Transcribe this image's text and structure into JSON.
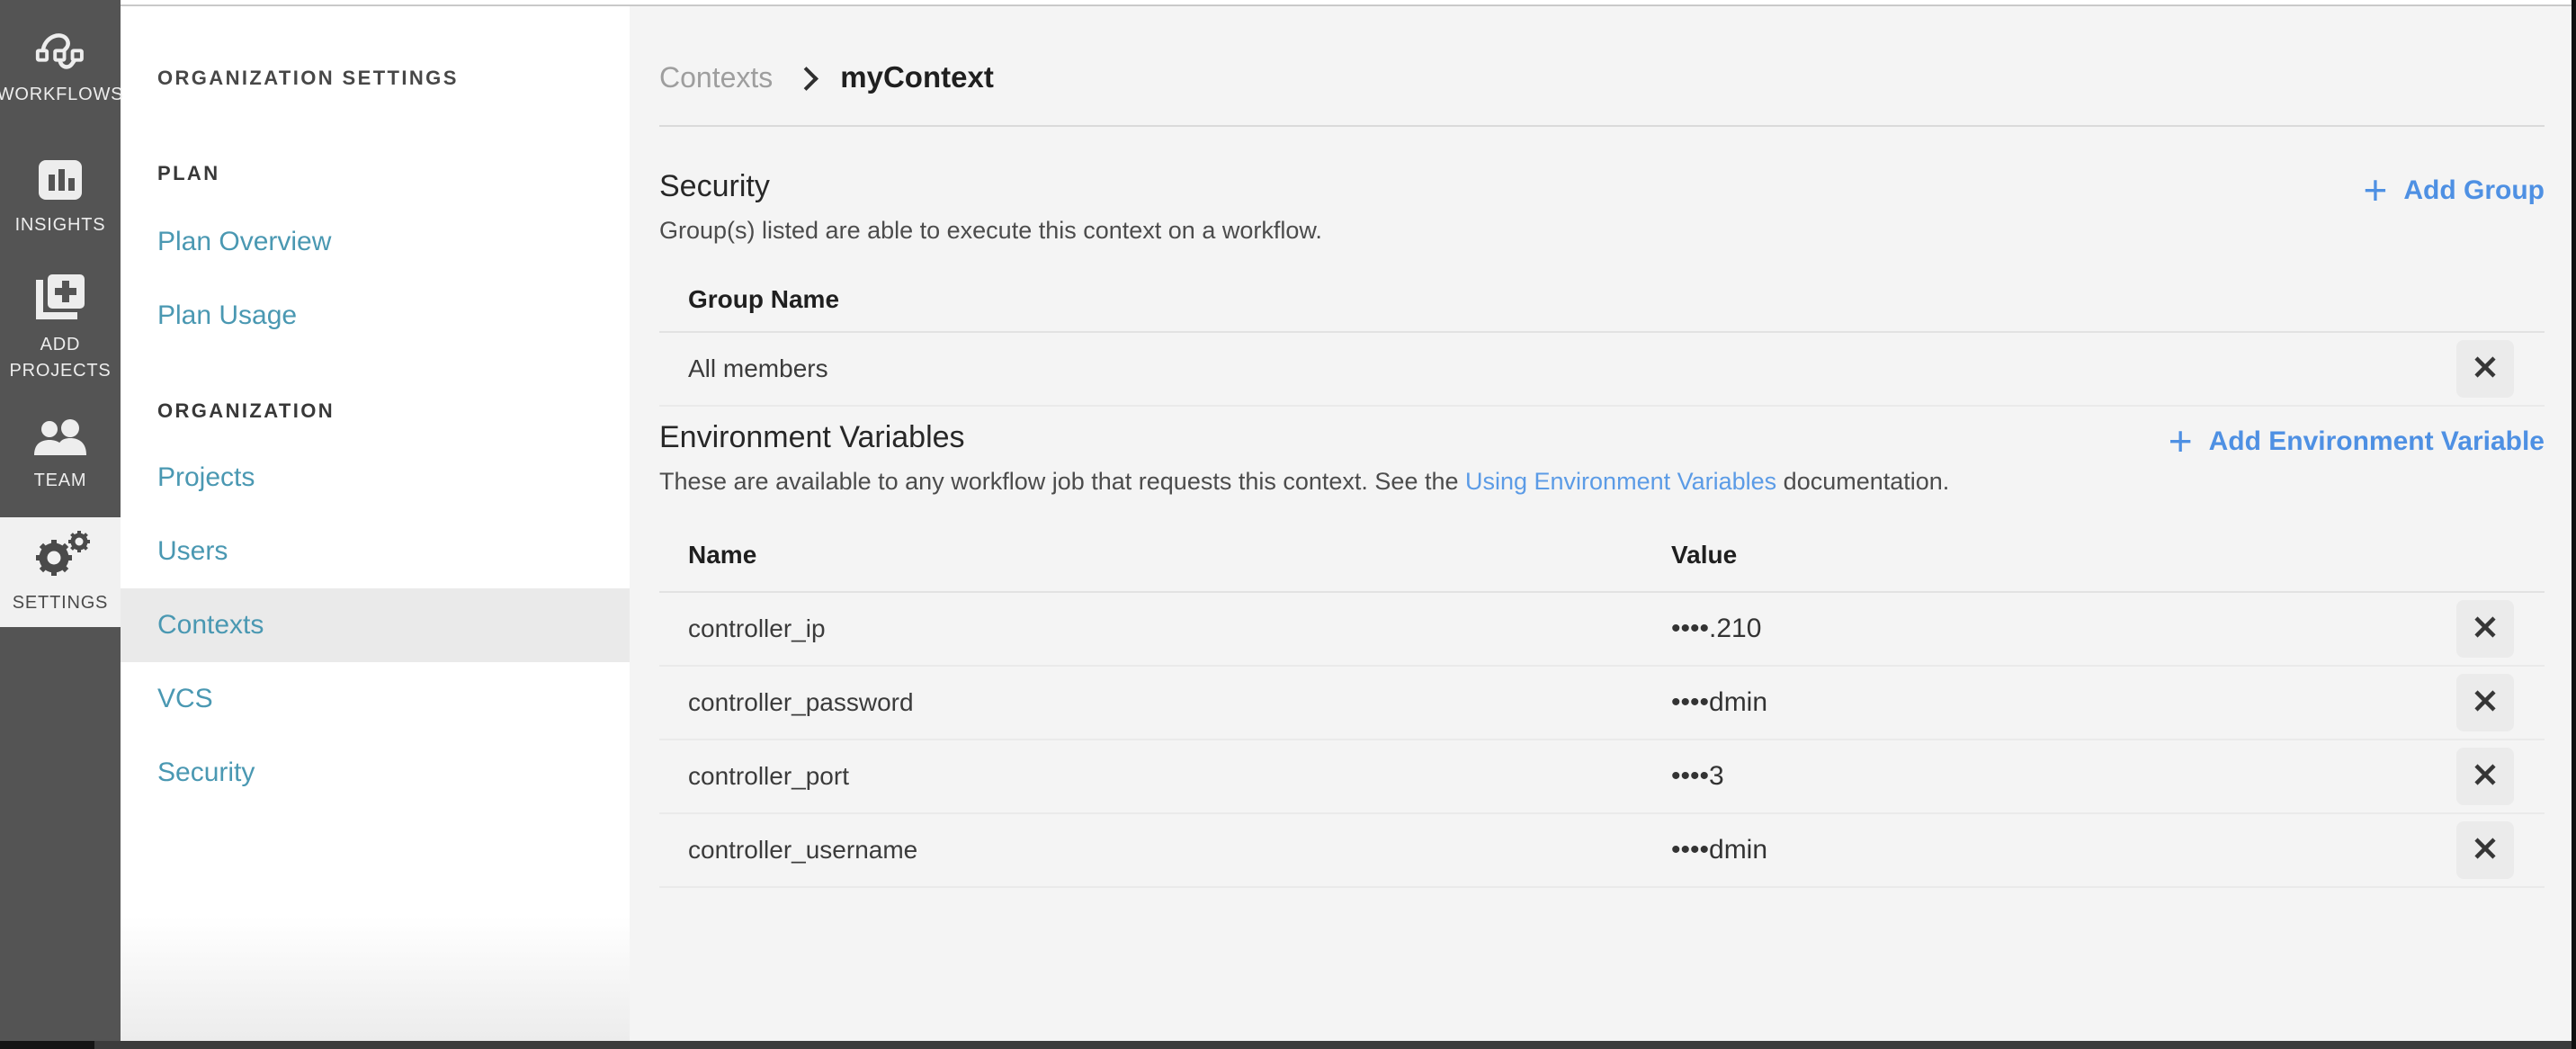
{
  "colors": {
    "accent_blue": "#4e90e3",
    "teal_link": "#4a98b2",
    "sidebar_dark": "#545454"
  },
  "icons": {
    "plus": "+"
  },
  "app_sidebar": {
    "items": [
      {
        "label": "WORKFLOWS",
        "icon": "workflows-icon"
      },
      {
        "label": "INSIGHTS",
        "icon": "insights-icon"
      },
      {
        "label": "ADD PROJECTS",
        "icon": "add-projects-icon"
      },
      {
        "label": "TEAM",
        "icon": "team-icon"
      },
      {
        "label": "SETTINGS",
        "icon": "settings-icon",
        "active": true
      }
    ]
  },
  "nav": {
    "title": "ORGANIZATION SETTINGS",
    "plan_header": "PLAN",
    "plan_links": [
      {
        "label": "Plan Overview"
      },
      {
        "label": "Plan Usage"
      }
    ],
    "org_header": "ORGANIZATION",
    "org_links": [
      {
        "label": "Projects"
      },
      {
        "label": "Users"
      },
      {
        "label": "Contexts",
        "active": true
      },
      {
        "label": "VCS"
      },
      {
        "label": "Security"
      }
    ]
  },
  "breadcrumb": {
    "parent": "Contexts",
    "current": "myContext"
  },
  "security": {
    "title": "Security",
    "description": "Group(s) listed are able to execute this context on a workflow.",
    "add_button_label": "Add Group",
    "group_name_header": "Group Name",
    "rows": [
      {
        "name": "All members"
      }
    ]
  },
  "env": {
    "title": "Environment Variables",
    "desc_prefix": "These are available to any workflow job that requests this context. See the ",
    "desc_link": "Using Environment Variables",
    "desc_suffix": " documentation.",
    "add_button_label": "Add Environment Variable",
    "name_header": "Name",
    "value_header": "Value",
    "rows": [
      {
        "name": "controller_ip",
        "value": "••••.210"
      },
      {
        "name": "controller_password",
        "value": "••••dmin"
      },
      {
        "name": "controller_port",
        "value": "••••3"
      },
      {
        "name": "controller_username",
        "value": "••••dmin"
      }
    ]
  }
}
